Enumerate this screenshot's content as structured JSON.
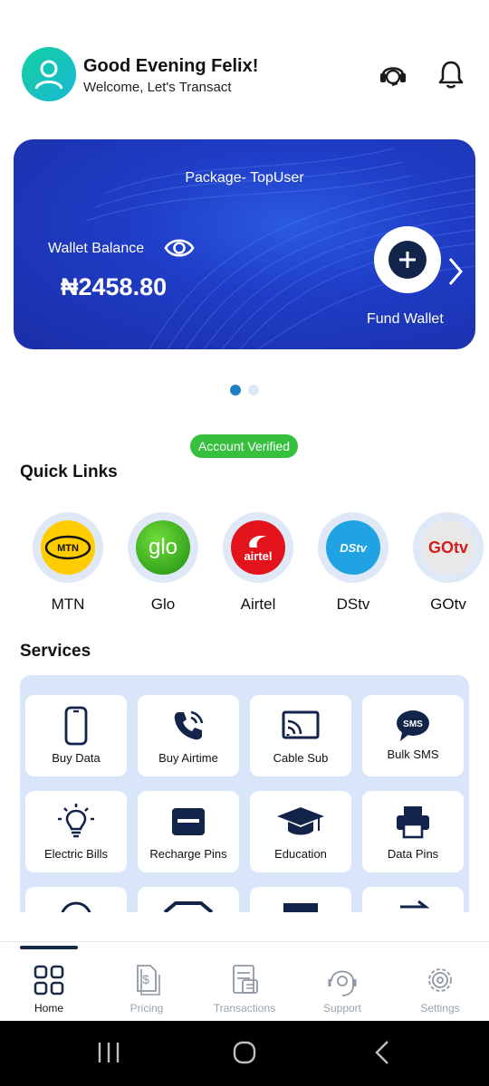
{
  "header": {
    "greeting": "Good Evening Felix!",
    "welcome": "Welcome, Let's Transact",
    "icons": [
      "user-icon",
      "support-headset-icon",
      "bell-icon"
    ]
  },
  "wallet": {
    "package": "Package- TopUser",
    "balance_label": "Wallet Balance",
    "balance": "₦2458.80",
    "fund_label": "Fund Wallet"
  },
  "carousel": {
    "pages": 2,
    "active": 1
  },
  "account_badge": "Account Verified",
  "quick_links": {
    "title": "Quick Links",
    "items": [
      {
        "name": "MTN",
        "logo_text": "MTN"
      },
      {
        "name": "Glo",
        "logo_text": "glo"
      },
      {
        "name": "Airtel",
        "logo_text": "airtel"
      },
      {
        "name": "DStv",
        "logo_text": "DStv"
      },
      {
        "name": "GOtv",
        "logo_text": "GOtv"
      }
    ]
  },
  "services": {
    "title": "Services",
    "items": [
      {
        "label": "Buy Data",
        "icon": "phone-icon"
      },
      {
        "label": "Buy Airtime",
        "icon": "phone-call-icon"
      },
      {
        "label": "Cable Sub",
        "icon": "cast-icon"
      },
      {
        "label": "Bulk SMS",
        "icon": "sms-bubble-icon"
      },
      {
        "label": "Electric Bills",
        "icon": "lightbulb-icon"
      },
      {
        "label": "Recharge Pins",
        "icon": "card-icon"
      },
      {
        "label": "Education",
        "icon": "graduation-cap-icon"
      },
      {
        "label": "Data Pins",
        "icon": "printer-icon"
      }
    ]
  },
  "nav": {
    "items": [
      {
        "label": "Home",
        "icon": "grid-icon",
        "active": true
      },
      {
        "label": "Pricing",
        "icon": "price-tag-icon",
        "active": false
      },
      {
        "label": "Transactions",
        "icon": "transactions-icon",
        "active": false
      },
      {
        "label": "Support",
        "icon": "support-icon",
        "active": false
      },
      {
        "label": "Settings",
        "icon": "gear-icon",
        "active": false
      }
    ]
  },
  "colors": {
    "card": "#1f3dc6",
    "dark": "#13244a",
    "verified": "#36c03d",
    "panel": "#d9e6fa"
  }
}
